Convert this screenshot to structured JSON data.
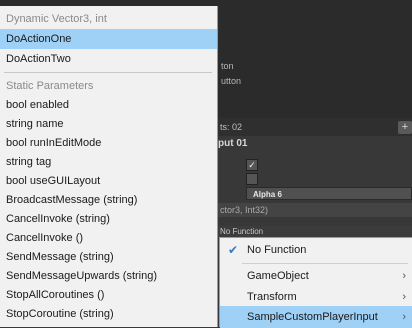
{
  "background": {
    "button_label_1": "ton",
    "button_label_2": "utton",
    "count_label": "ts: 02",
    "plus": "+",
    "input_header": "put 01",
    "check_1": "✓",
    "check_2": "",
    "alpha_field": "Alpha 6",
    "signature": "ctor3, Int32)",
    "no_function_field": "No Function"
  },
  "left_menu": {
    "dynamic_header": "Dynamic Vector3, int",
    "dynamic_items": [
      "DoActionOne",
      "DoActionTwo"
    ],
    "static_header": "Static Parameters",
    "static_items": [
      "bool enabled",
      "string name",
      "bool runInEditMode",
      "string tag",
      "bool useGUILayout",
      "BroadcastMessage (string)",
      "CancelInvoke (string)",
      "CancelInvoke ()",
      "SendMessage (string)",
      "SendMessageUpwards (string)",
      "StopAllCoroutines ()",
      "StopCoroutine (string)"
    ]
  },
  "right_menu": {
    "no_function": "No Function",
    "items": [
      "GameObject",
      "Transform",
      "SampleCustomPlayerInput"
    ]
  },
  "colors": {
    "highlight": "#9fd0f5",
    "menu_bg": "#f1f1f1",
    "editor_bg": "#383838"
  }
}
